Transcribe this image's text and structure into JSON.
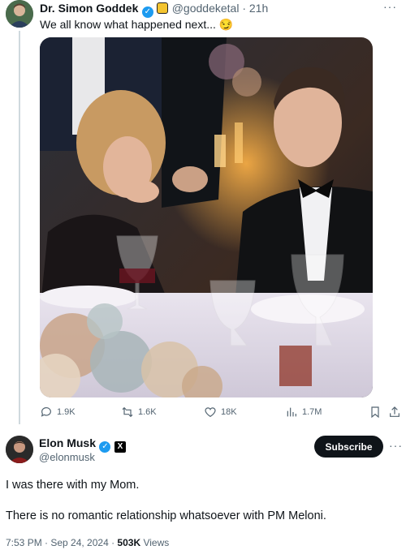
{
  "tweet1": {
    "name": "Dr. Simon Goddek",
    "handle": "@goddeketal",
    "time": "21h",
    "text": "We all know what happened next... 😏",
    "stats": {
      "replies": "1.9K",
      "reposts": "1.6K",
      "likes": "18K",
      "views": "1.7M"
    }
  },
  "tweet2": {
    "name": "Elon Musk",
    "handle": "@elonmusk",
    "subscribe_label": "Subscribe",
    "line1": "I was there with my Mom.",
    "line2": "There is no romantic relationship whatsoever with PM Meloni.",
    "timestamp": "7:53 PM · Sep 24, 2024 · ",
    "views_count": "503K",
    "views_label": " Views"
  },
  "icons": {
    "more": "more-dots-icon",
    "reply": "reply-icon",
    "repost": "repost-icon",
    "like": "heart-icon",
    "views": "chart-icon",
    "bookmark": "bookmark-icon",
    "share": "share-icon"
  },
  "colors": {
    "verified": "#1d9bf0",
    "text_secondary": "#536471",
    "subscribe_bg": "#0f1419"
  }
}
